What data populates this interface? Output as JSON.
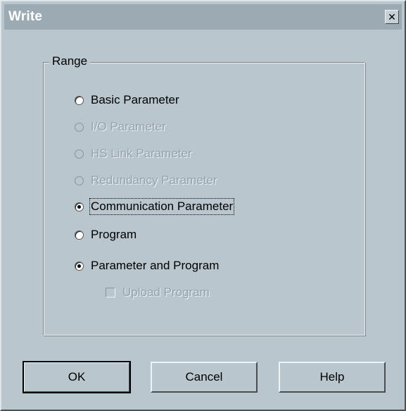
{
  "window": {
    "title": "Write",
    "close_glyph": "✕"
  },
  "range": {
    "legend": "Range",
    "options": [
      {
        "label": "Basic Parameter",
        "checked": false,
        "enabled": true
      },
      {
        "label": "I/O Parameter",
        "checked": false,
        "enabled": false
      },
      {
        "label": "HS Link Parameter",
        "checked": false,
        "enabled": false
      },
      {
        "label": "Redundancy Parameter",
        "checked": false,
        "enabled": false
      },
      {
        "label": "Communication Parameter",
        "checked": true,
        "enabled": true,
        "focused": true
      },
      {
        "label": "Program",
        "checked": false,
        "enabled": true
      },
      {
        "label": "Parameter and Program",
        "checked": true,
        "enabled": true
      }
    ],
    "upload_program": {
      "label": "Upload Program",
      "checked": false,
      "enabled": false
    }
  },
  "buttons": {
    "ok": "OK",
    "cancel": "Cancel",
    "help": "Help"
  },
  "colors": {
    "dialog_bg": "#b9c6ce",
    "titlebar_bg": "#9caab4",
    "disabled_text": "#95a3ad"
  }
}
